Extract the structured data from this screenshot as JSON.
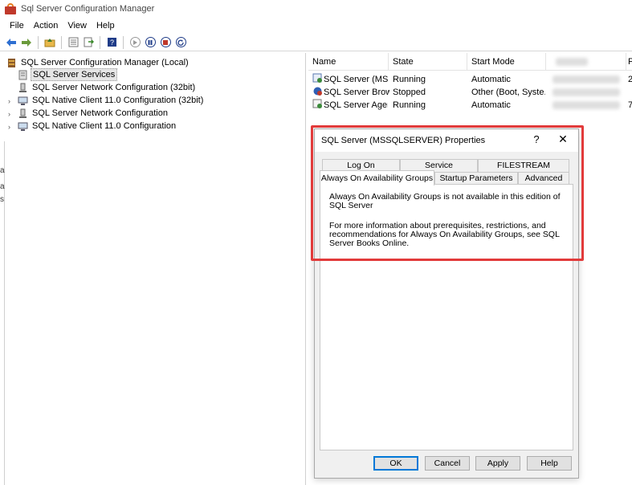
{
  "window": {
    "title": "Sql Server Configuration Manager"
  },
  "menu": [
    "File",
    "Action",
    "View",
    "Help"
  ],
  "toolbar": {
    "icons": [
      "back-arrow-icon",
      "forward-arrow-icon",
      "up-folder-icon",
      "properties-icon",
      "export-icon",
      "help-icon",
      "start-icon",
      "pause-icon",
      "stop-icon",
      "restart-icon"
    ]
  },
  "tree": {
    "root": "SQL Server Configuration Manager (Local)",
    "items": [
      "SQL Server Services",
      "SQL Server Network Configuration (32bit)",
      "SQL Native Client 11.0 Configuration (32bit)",
      "SQL Server Network Configuration",
      "SQL Native Client 11.0 Configuration"
    ]
  },
  "left_strip": {
    "chars": [
      "a",
      "a",
      "s"
    ]
  },
  "list": {
    "columns": [
      "Name",
      "State",
      "Start Mode",
      "",
      "F"
    ],
    "rows": [
      {
        "name": "SQL Server (MSS...",
        "state": "Running",
        "mode": "Automatic",
        "tail": "2"
      },
      {
        "name": "SQL Server Browser",
        "state": "Stopped",
        "mode": "Other (Boot, Syste...",
        "tail": ""
      },
      {
        "name": "SQL Server Agent...",
        "state": "Running",
        "mode": "Automatic",
        "tail": "7"
      }
    ]
  },
  "dialog": {
    "title": "SQL Server (MSSQLSERVER) Properties",
    "help": "?",
    "close": "✕",
    "tabs_back": [
      "Log On",
      "Service",
      "FILESTREAM"
    ],
    "tabs_front": [
      "Always On Availability Groups",
      "Startup Parameters",
      "Advanced"
    ],
    "panel": {
      "p1": "Always On Availability Groups is not available in this edition of SQL Server",
      "p2": "For more information about prerequisites, restrictions, and recommendations for Always On Availability Groups, see SQL Server Books Online."
    },
    "buttons": {
      "ok": "OK",
      "cancel": "Cancel",
      "apply": "Apply",
      "help": "Help"
    }
  },
  "colors": {
    "highlight": "#e23b3b",
    "accent": "#0078d7",
    "toolbar_blue": "#1f3c88"
  }
}
